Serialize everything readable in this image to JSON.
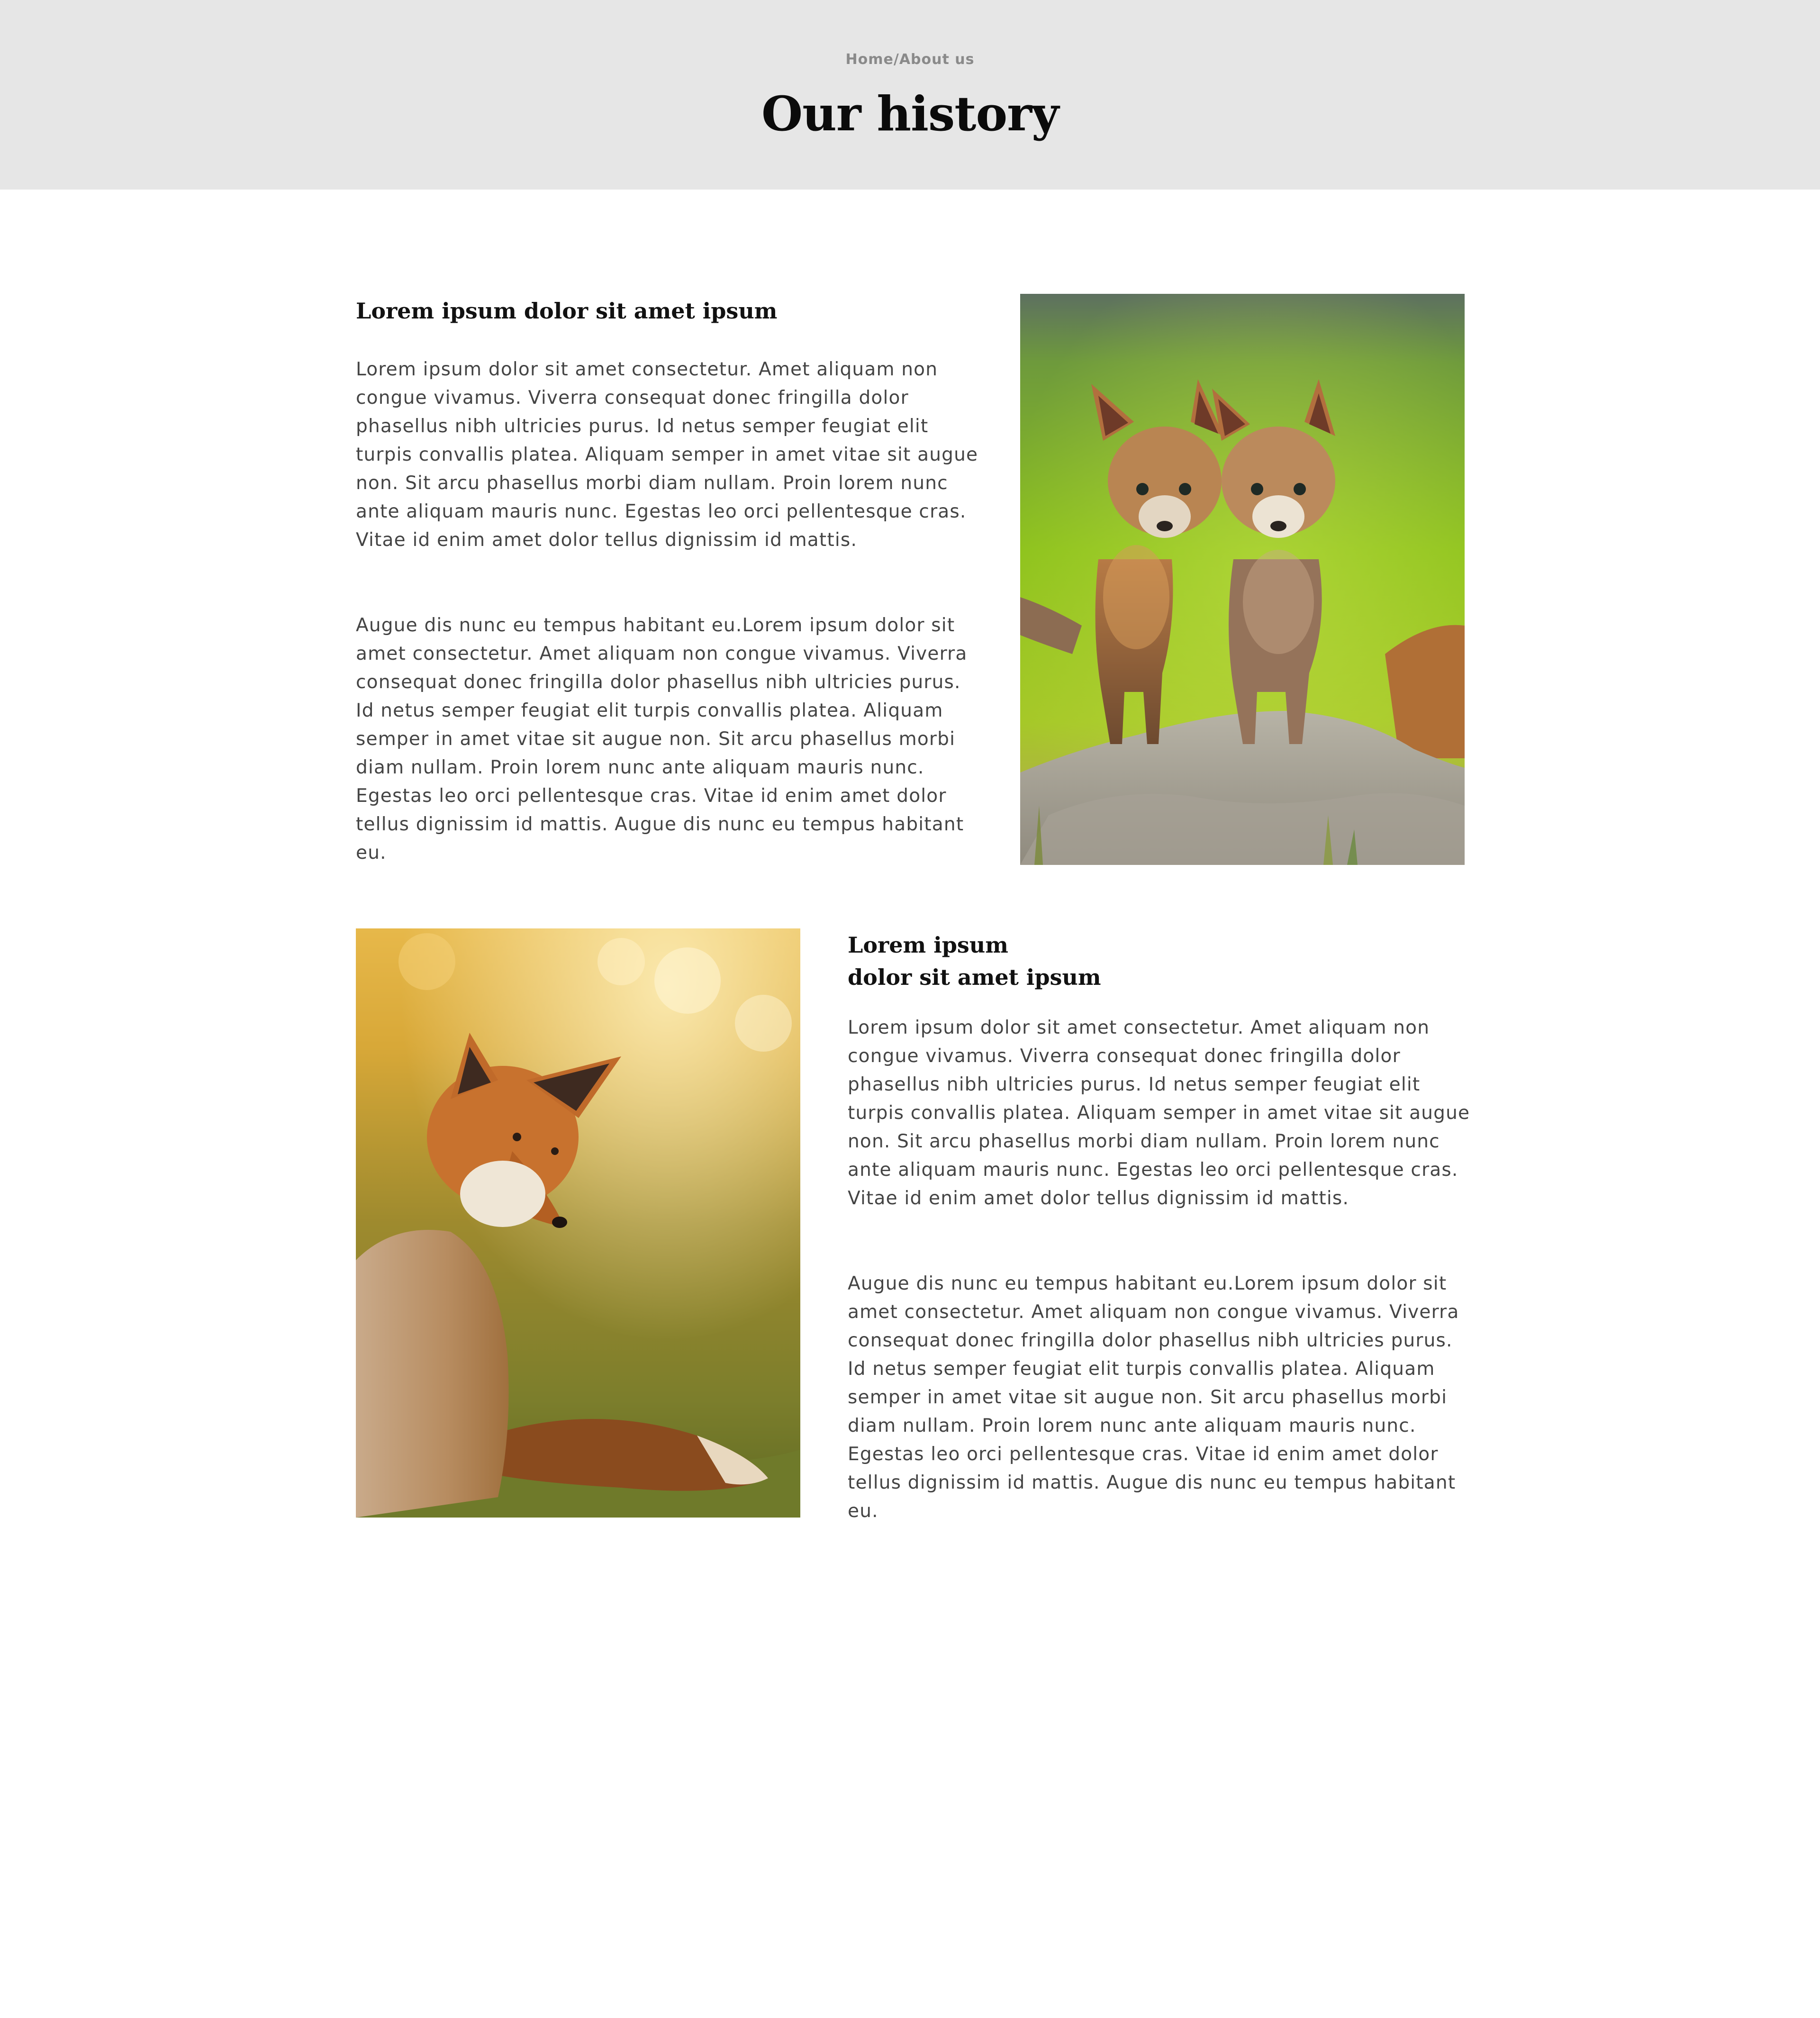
{
  "header": {
    "breadcrumb": {
      "home": "Home",
      "separator": "/",
      "current": "About us"
    },
    "title": "Our history"
  },
  "sections": [
    {
      "heading_line1": "Lorem ipsum dolor sit amet ipsum",
      "paragraphs": [
        "Lorem ipsum dolor sit amet consectetur. Amet aliquam non congue vivamus. Viverra consequat donec fringilla dolor phasellus nibh ultricies purus. Id netus semper feugiat elit turpis convallis platea. Aliquam semper in amet vitae sit augue non. Sit arcu phasellus morbi diam nullam. Proin lorem nunc ante aliquam mauris nunc. Egestas leo orci pellentesque cras. Vitae id enim amet dolor tellus dignissim id mattis.",
        "Augue dis nunc eu tempus habitant eu.Lorem ipsum dolor sit amet consectetur. Amet aliquam non congue vivamus. Viverra consequat donec fringilla dolor phasellus nibh ultricies purus. Id netus semper feugiat elit turpis convallis platea. Aliquam semper in amet vitae sit augue non. Sit arcu phasellus morbi diam nullam. Proin lorem nunc ante aliquam mauris nunc. Egestas leo orci pellentesque cras. Vitae id enim amet dolor tellus dignissim id mattis. Augue dis nunc eu tempus habitant eu."
      ],
      "image": "two-fox-cubs-photo"
    },
    {
      "heading_line1": "Lorem ipsum",
      "heading_line2": "dolor sit amet ipsum",
      "paragraphs": [
        "Lorem ipsum dolor sit amet consectetur. Amet aliquam non congue vivamus. Viverra consequat donec fringilla dolor phasellus nibh ultricies purus. Id netus semper feugiat elit turpis convallis platea. Aliquam semper in amet vitae sit augue non. Sit arcu phasellus morbi diam nullam. Proin lorem nunc ante aliquam mauris nunc. Egestas leo orci pellentesque cras. Vitae id enim amet dolor tellus dignissim id mattis.",
        "Augue dis nunc eu tempus habitant eu.Lorem ipsum dolor sit amet consectetur. Amet aliquam non congue vivamus. Viverra consequat donec fringilla dolor phasellus nibh ultricies purus. Id netus semper feugiat elit turpis convallis platea. Aliquam semper in amet vitae sit augue non. Sit arcu phasellus morbi diam nullam. Proin lorem nunc ante aliquam mauris nunc. Egestas leo orci pellentesque cras. Vitae id enim amet dolor tellus dignissim id mattis. Augue dis nunc eu tempus habitant eu."
      ],
      "image": "red-fox-sitting-photo"
    }
  ],
  "colors": {
    "hero_background": "#e6e6e6",
    "title": "#0b0b0b",
    "body_text": "#444444",
    "breadcrumb": "#8a8a8a"
  }
}
